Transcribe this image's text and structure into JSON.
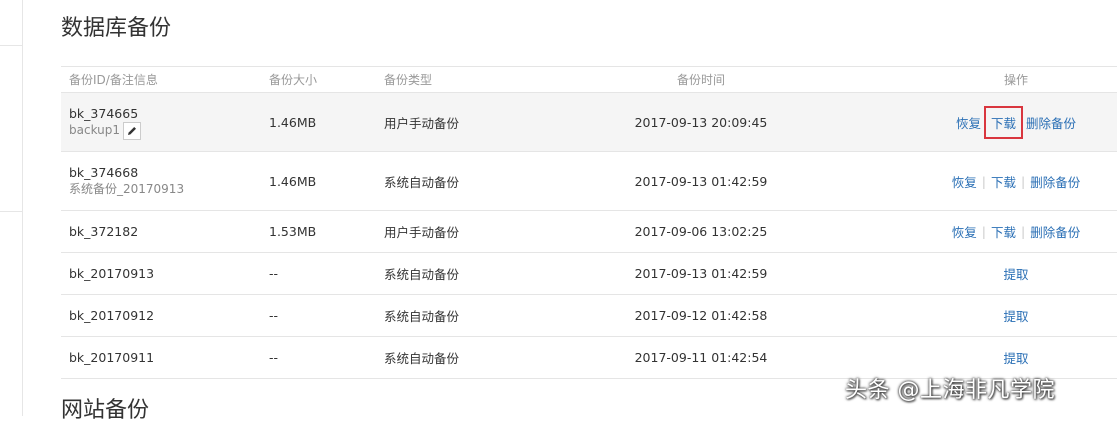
{
  "page_title": "数据库备份",
  "section2_title": "网站备份",
  "table": {
    "headers": {
      "id": "备份ID/备注信息",
      "size": "备份大小",
      "type": "备份类型",
      "time": "备份时间",
      "ops": "操作"
    },
    "rows": [
      {
        "id": "bk_374665",
        "note": "backup1",
        "size": "1.46MB",
        "type": "用户手动备份",
        "time": "2017-09-13 20:09:45",
        "ops": [
          "恢复",
          "下载",
          "删除备份"
        ]
      },
      {
        "id": "bk_374668",
        "note": "系统备份_20170913",
        "size": "1.46MB",
        "type": "系统自动备份",
        "time": "2017-09-13 01:42:59",
        "ops": [
          "恢复",
          "下载",
          "删除备份"
        ]
      },
      {
        "id": "bk_372182",
        "size": "1.53MB",
        "type": "用户手动备份",
        "time": "2017-09-06 13:02:25",
        "ops": [
          "恢复",
          "下载",
          "删除备份"
        ]
      },
      {
        "id": "bk_20170913",
        "size": "--",
        "type": "系统自动备份",
        "time": "2017-09-13 01:42:59",
        "ops": [
          "提取"
        ]
      },
      {
        "id": "bk_20170912",
        "size": "--",
        "type": "系统自动备份",
        "time": "2017-09-12 01:42:58",
        "ops": [
          "提取"
        ]
      },
      {
        "id": "bk_20170911",
        "size": "--",
        "type": "系统自动备份",
        "time": "2017-09-11 01:42:54",
        "ops": [
          "提取"
        ]
      }
    ]
  },
  "watermark": "头条 @上海非凡学院",
  "colors": {
    "link": "#2a6fb5",
    "highlight_border": "#d9363e"
  },
  "icons": {
    "edit": "pencil-icon"
  }
}
